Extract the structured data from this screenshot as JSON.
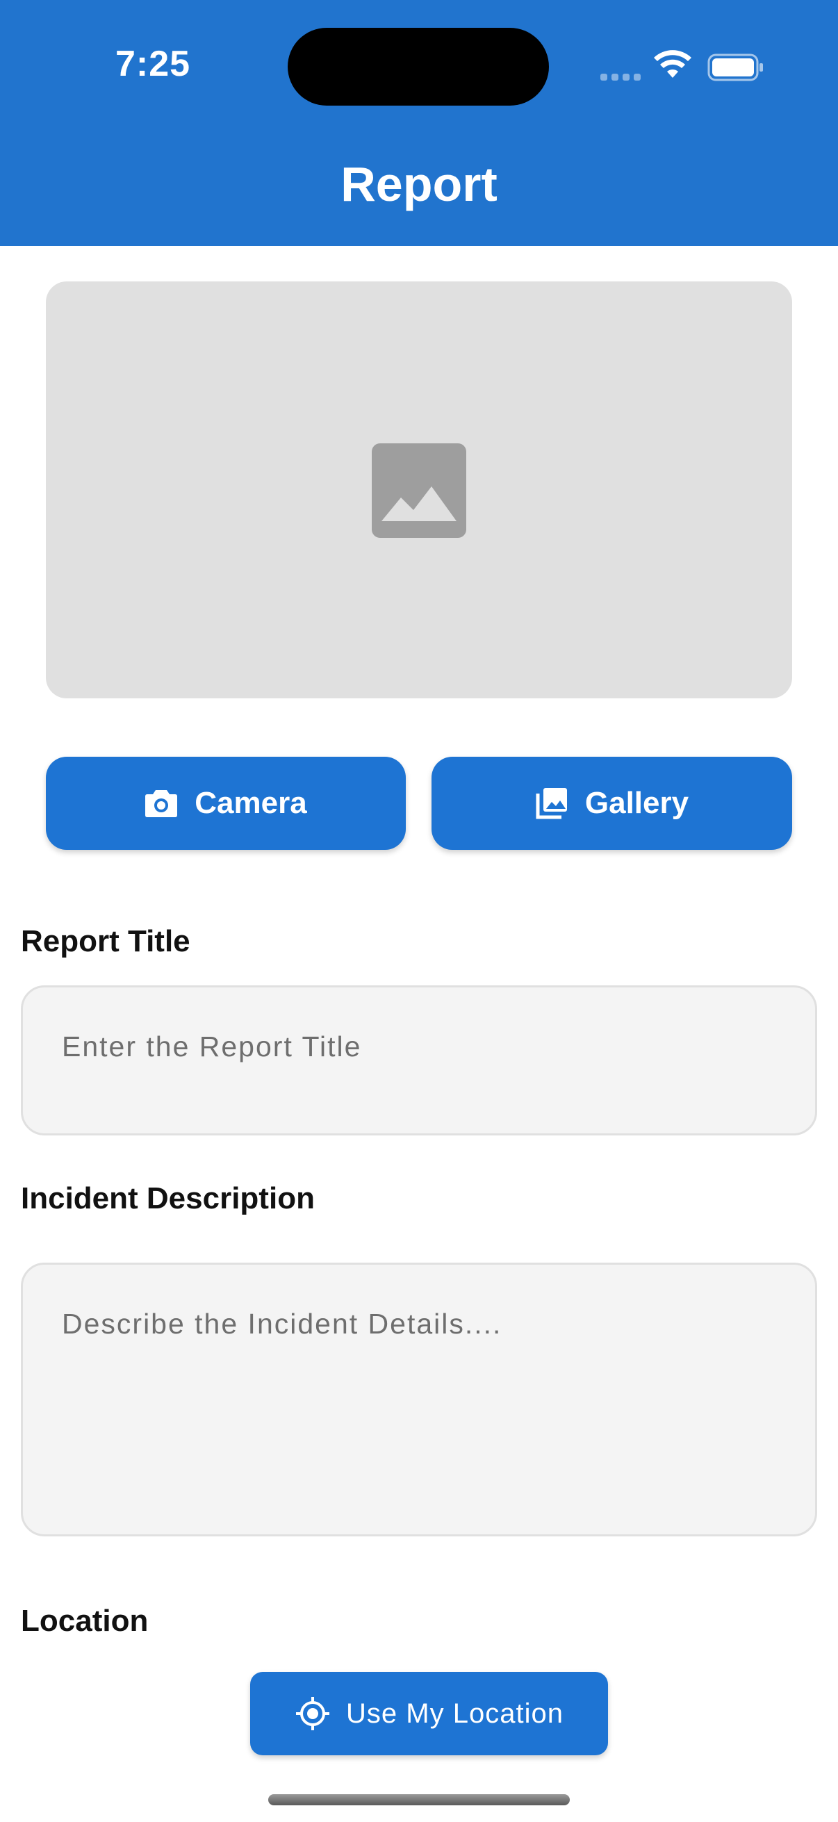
{
  "status_bar": {
    "time": "7:25"
  },
  "header": {
    "title": "Report"
  },
  "image_picker": {
    "icon": "image-placeholder-icon",
    "camera_label": "Camera",
    "gallery_label": "Gallery"
  },
  "form": {
    "title_label": "Report Title",
    "title_placeholder": "Enter the Report Title",
    "description_label": "Incident Description",
    "description_placeholder": "Describe the Incident Details....",
    "location_label": "Location",
    "location_button": "Use My Location"
  },
  "colors": {
    "header": "#2174CE",
    "button": "#1E74D3",
    "placeholder_bg": "#E0E0E0",
    "field_bg": "#F4F4F4"
  }
}
